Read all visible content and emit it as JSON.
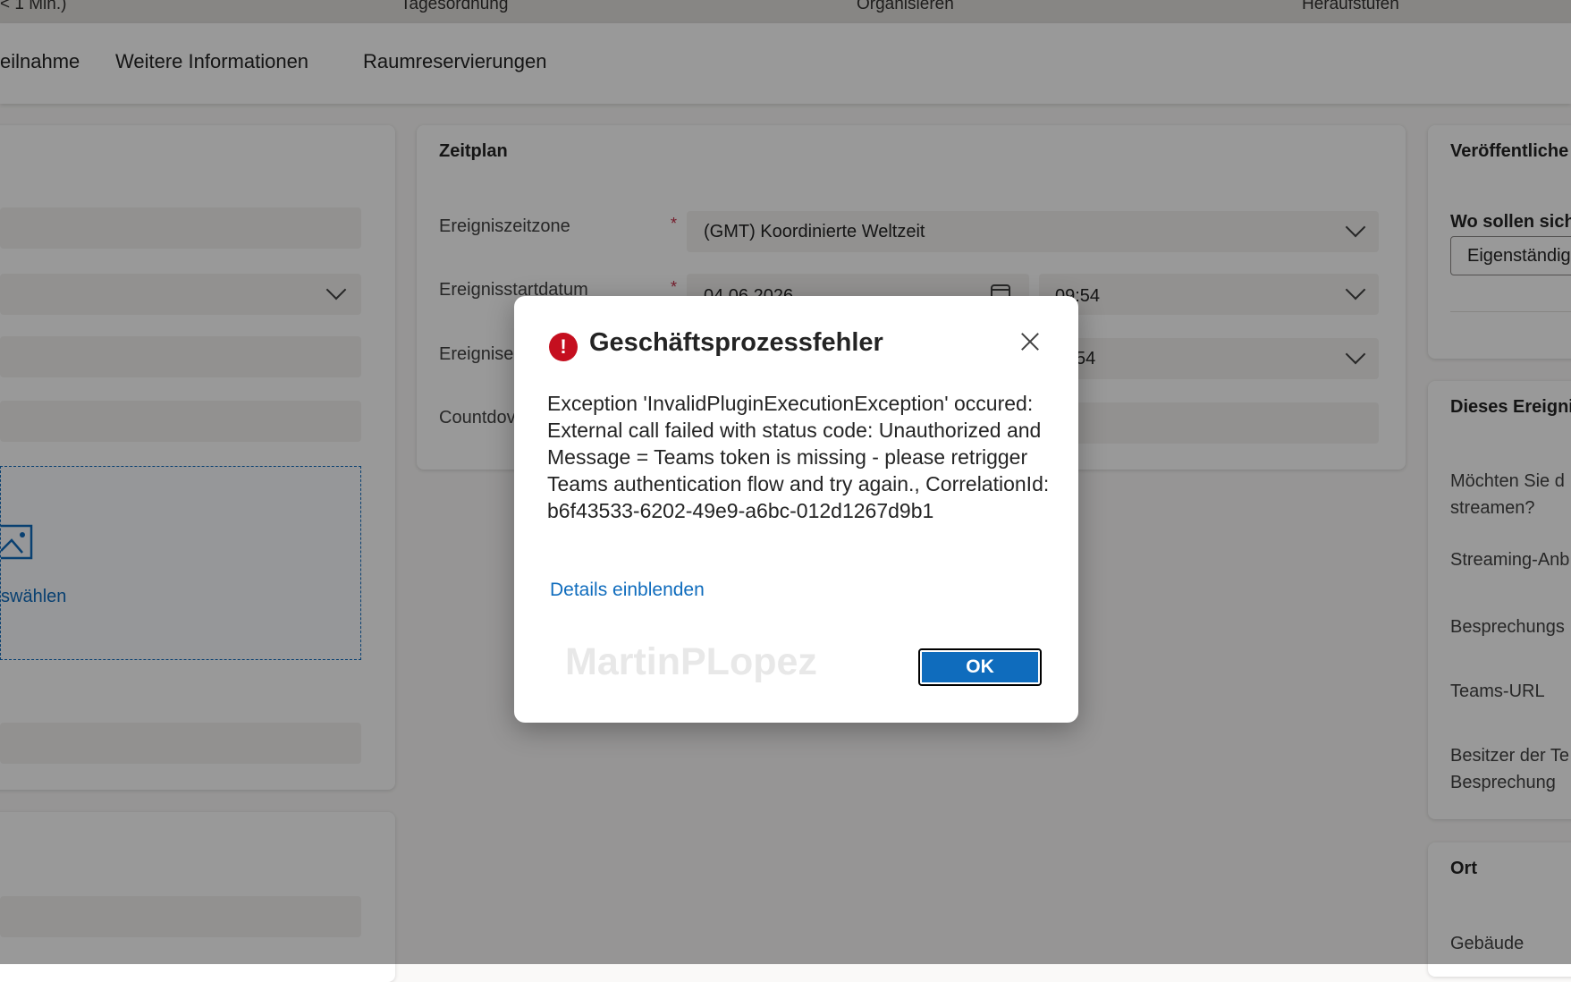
{
  "topbar": {
    "items": [
      "< 1 Min.)",
      "Tagesordnung",
      "Organisieren",
      "Heraufstufen"
    ]
  },
  "tabs": [
    "eilnahme",
    "Weitere Informationen",
    "Raumreservierungen"
  ],
  "left_card": {
    "image_link": "swählen"
  },
  "schedule": {
    "title": "Zeitplan",
    "fields": [
      {
        "label": "Ereigniszeitzone",
        "required": "*",
        "value": "(GMT) Koordinierte Weltzeit"
      },
      {
        "label": "Ereignisstartdatum",
        "required": "*",
        "date": "04.06.2026",
        "time": "09:54"
      },
      {
        "label": "Ereignise",
        "time": "54"
      },
      {
        "label": "Countdov"
      }
    ]
  },
  "right_column": {
    "publish": {
      "title": "Veröffentliche",
      "question": "Wo sollen sich",
      "value": "Eigenständig"
    },
    "event": {
      "title": "Dieses Ereigni",
      "items": [
        "Möchten Sie d",
        "streamen?",
        "Streaming-Anb",
        "Besprechungs",
        "Teams-URL",
        "Besitzer der Te",
        "Besprechung"
      ]
    },
    "location": {
      "title": "Ort",
      "items": [
        "Gebäude"
      ]
    }
  },
  "dialog": {
    "title": "Geschäftsprozessfehler",
    "icon_glyph": "!",
    "message": "Exception 'InvalidPluginExecutionException' occured: External call failed with status code: Unauthorized and Message = Teams token is missing - please retrigger Teams authentication flow and try again., CorrelationId: b6f43533-6202-49e9-a6bc-012d1267d9b1",
    "details_link": "Details einblenden",
    "watermark": "MartinPLopez",
    "ok_label": "OK"
  },
  "colors": {
    "accent": "#0f6cbd",
    "error": "#c50f1f"
  }
}
